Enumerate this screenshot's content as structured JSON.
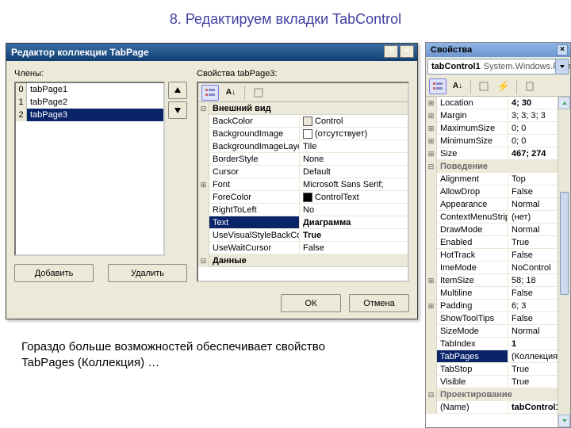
{
  "heading": "8. Редактируем вкладки TabControl",
  "footnote": "Гораздо больше возможностей обеспечивает свойство TabPages (Коллекция) …",
  "collectionEditor": {
    "title": "Редактор коллекции TabPage",
    "membersLabel": "Члены:",
    "propsLabel": "Свойства tabPage3:",
    "helpBtn": "?",
    "closeBtn": "×",
    "members": [
      {
        "idx": "0",
        "name": "tabPage1",
        "selected": false
      },
      {
        "idx": "1",
        "name": "tabPage2",
        "selected": false
      },
      {
        "idx": "2",
        "name": "tabPage3",
        "selected": true
      }
    ],
    "addBtn": "Добавить",
    "removeBtn": "Удалить",
    "okBtn": "ОК",
    "cancelBtn": "Отмена",
    "grid": [
      {
        "type": "cat",
        "gut": "⊟",
        "name": "Внешний вид"
      },
      {
        "type": "row",
        "gut": "",
        "name": "BackColor",
        "val": "Control",
        "swatch": "#ece9d8"
      },
      {
        "type": "row",
        "gut": "",
        "name": "BackgroundImage",
        "val": "(отсутствует)",
        "swatch": "#ffffff"
      },
      {
        "type": "row",
        "gut": "",
        "name": "BackgroundImageLayout",
        "val": "Tile"
      },
      {
        "type": "row",
        "gut": "",
        "name": "BorderStyle",
        "val": "None"
      },
      {
        "type": "row",
        "gut": "",
        "name": "Cursor",
        "val": "Default"
      },
      {
        "type": "row",
        "gut": "⊞",
        "name": "Font",
        "val": "Microsoft Sans Serif;"
      },
      {
        "type": "row",
        "gut": "",
        "name": "ForeColor",
        "val": "ControlText",
        "swatch": "#000000"
      },
      {
        "type": "row",
        "gut": "",
        "name": "RightToLeft",
        "val": "No"
      },
      {
        "type": "row",
        "gut": "",
        "name": "Text",
        "val": "Диаграмма",
        "bold": true,
        "selected": true
      },
      {
        "type": "row",
        "gut": "",
        "name": "UseVisualStyleBackColor",
        "val": "True",
        "bold": true
      },
      {
        "type": "row",
        "gut": "",
        "name": "UseWaitCursor",
        "val": "False"
      },
      {
        "type": "cat",
        "gut": "⊟",
        "name": "Данные"
      }
    ]
  },
  "propsPanel": {
    "title": "Свойства",
    "object": {
      "name": "tabControl1",
      "type": "System.Windows.Form"
    },
    "grid": [
      {
        "type": "row",
        "gut": "⊞",
        "name": "Location",
        "val": "4; 30",
        "bold": true
      },
      {
        "type": "row",
        "gut": "⊞",
        "name": "Margin",
        "val": "3; 3; 3; 3"
      },
      {
        "type": "row",
        "gut": "⊞",
        "name": "MaximumSize",
        "val": "0; 0"
      },
      {
        "type": "row",
        "gut": "⊞",
        "name": "MinimumSize",
        "val": "0; 0"
      },
      {
        "type": "row",
        "gut": "⊞",
        "name": "Size",
        "val": "467; 274",
        "bold": true
      },
      {
        "type": "cat",
        "gut": "⊟",
        "name": "Поведение"
      },
      {
        "type": "row",
        "gut": "",
        "name": "Alignment",
        "val": "Top"
      },
      {
        "type": "row",
        "gut": "",
        "name": "AllowDrop",
        "val": "False"
      },
      {
        "type": "row",
        "gut": "",
        "name": "Appearance",
        "val": "Normal"
      },
      {
        "type": "row",
        "gut": "",
        "name": "ContextMenuStrip",
        "val": "(нет)"
      },
      {
        "type": "row",
        "gut": "",
        "name": "DrawMode",
        "val": "Normal"
      },
      {
        "type": "row",
        "gut": "",
        "name": "Enabled",
        "val": "True"
      },
      {
        "type": "row",
        "gut": "",
        "name": "HotTrack",
        "val": "False"
      },
      {
        "type": "row",
        "gut": "",
        "name": "ImeMode",
        "val": "NoControl"
      },
      {
        "type": "row",
        "gut": "⊞",
        "name": "ItemSize",
        "val": "58; 18"
      },
      {
        "type": "row",
        "gut": "",
        "name": "Multiline",
        "val": "False"
      },
      {
        "type": "row",
        "gut": "⊞",
        "name": "Padding",
        "val": "6; 3"
      },
      {
        "type": "row",
        "gut": "",
        "name": "ShowToolTips",
        "val": "False"
      },
      {
        "type": "row",
        "gut": "",
        "name": "SizeMode",
        "val": "Normal"
      },
      {
        "type": "row",
        "gut": "",
        "name": "TabIndex",
        "val": "1",
        "bold": true
      },
      {
        "type": "row",
        "gut": "",
        "name": "TabPages",
        "val": "(Коллекция)",
        "selected": true,
        "ellipsis": true
      },
      {
        "type": "row",
        "gut": "",
        "name": "TabStop",
        "val": "True"
      },
      {
        "type": "row",
        "gut": "",
        "name": "Visible",
        "val": "True"
      },
      {
        "type": "cat",
        "gut": "⊟",
        "name": "Проектирование"
      },
      {
        "type": "row",
        "gut": "",
        "name": "(Name)",
        "val": "tabControl1",
        "bold": true
      }
    ]
  }
}
